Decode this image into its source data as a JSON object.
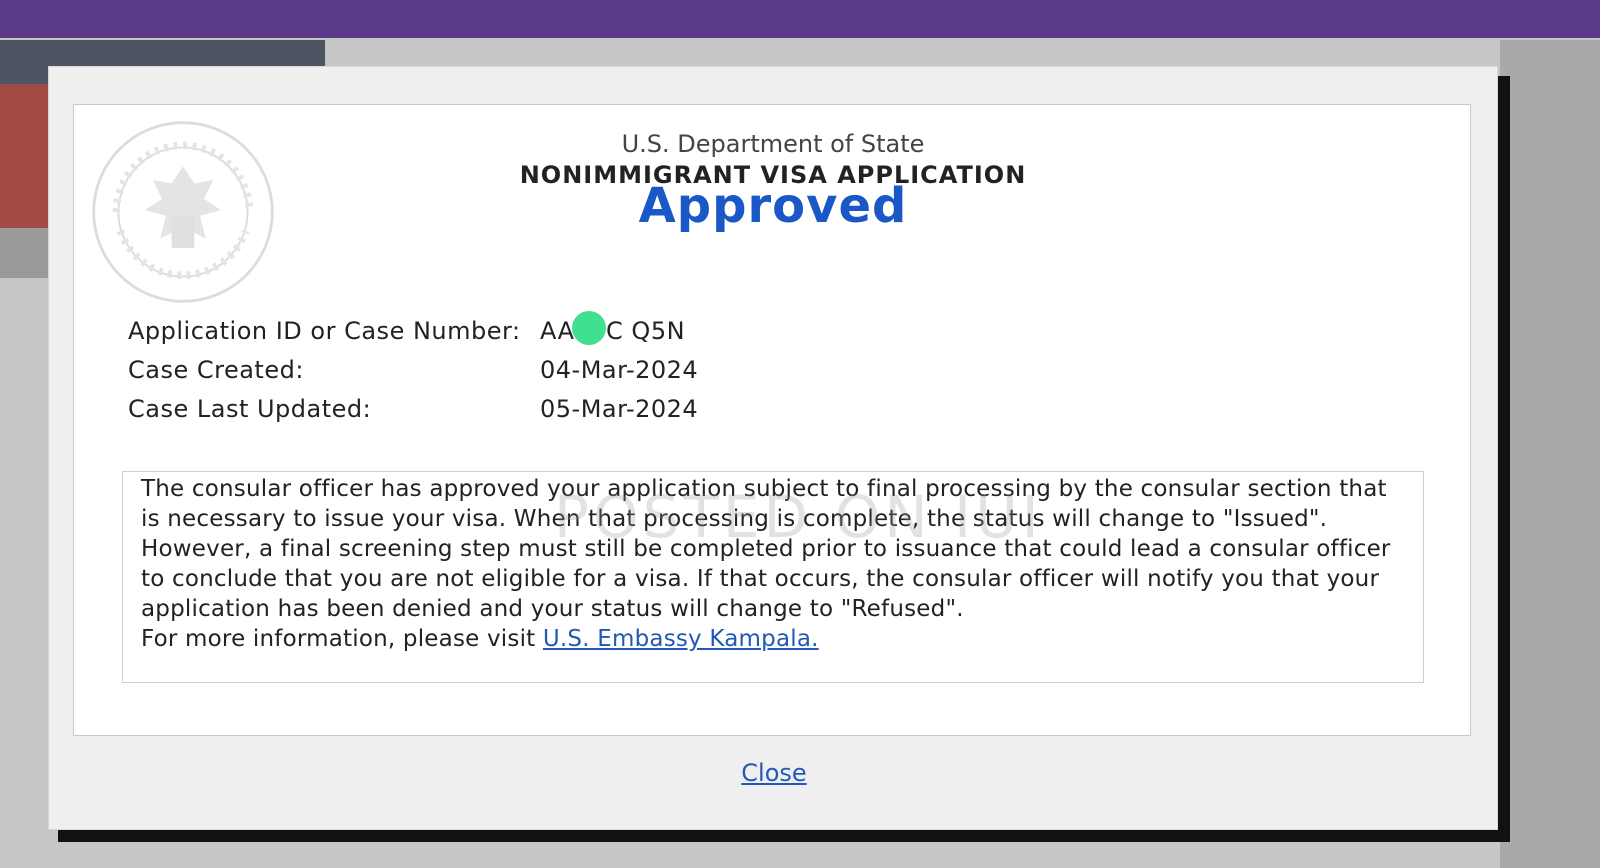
{
  "header": {
    "department": "U.S. Department of State",
    "form_title": "NONIMMIGRANT VISA APPLICATION",
    "seal_icon": "state-department-seal-icon"
  },
  "status": {
    "label": "Approved",
    "color": "#1a57c7"
  },
  "case_info": [
    {
      "label": "Application ID or Case Number:",
      "value": "AA00C  Q5N"
    },
    {
      "label": "Case Created:",
      "value": "04-Mar-2024"
    },
    {
      "label": "Case Last Updated:",
      "value": "05-Mar-2024"
    }
  ],
  "message": {
    "body": "The consular officer has approved your application subject to final processing by the consular section that is necessary to issue your visa. When that processing is complete, the status will change to \"Issued\". However, a final screening step must still be completed prior to issuance that could lead a consular officer to conclude that you are not eligible for a visa. If that occurs, the consular officer will notify you that your application has been denied and your status will change to \"Refused\".",
    "more_info_prefix": "For more information, please visit ",
    "more_info_link": "U.S. Embassy Kampala."
  },
  "watermark": "POSTED ON IUI",
  "actions": {
    "close_label": "Close"
  },
  "colors": {
    "top_bar": "#5b3a8a",
    "link": "#2159b5",
    "redaction_dot": "#3fe08f"
  }
}
